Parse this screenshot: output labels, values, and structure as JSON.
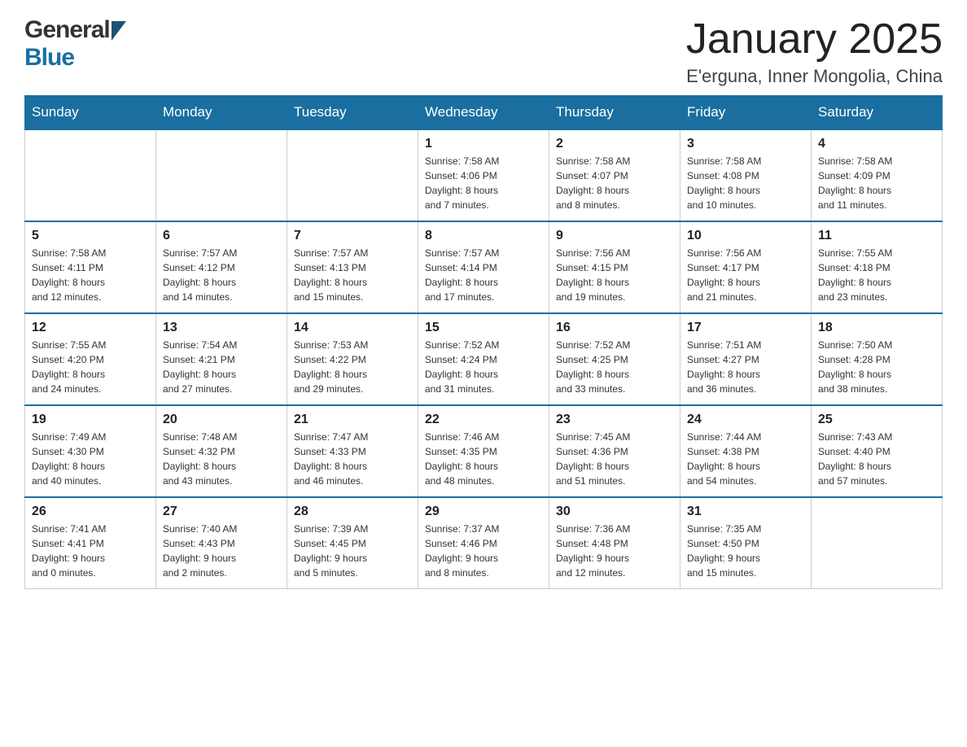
{
  "logo": {
    "general": "General",
    "blue": "Blue"
  },
  "title": "January 2025",
  "subtitle": "E'erguna, Inner Mongolia, China",
  "days_header": [
    "Sunday",
    "Monday",
    "Tuesday",
    "Wednesday",
    "Thursday",
    "Friday",
    "Saturday"
  ],
  "weeks": [
    [
      {
        "day": "",
        "info": ""
      },
      {
        "day": "",
        "info": ""
      },
      {
        "day": "",
        "info": ""
      },
      {
        "day": "1",
        "info": "Sunrise: 7:58 AM\nSunset: 4:06 PM\nDaylight: 8 hours\nand 7 minutes."
      },
      {
        "day": "2",
        "info": "Sunrise: 7:58 AM\nSunset: 4:07 PM\nDaylight: 8 hours\nand 8 minutes."
      },
      {
        "day": "3",
        "info": "Sunrise: 7:58 AM\nSunset: 4:08 PM\nDaylight: 8 hours\nand 10 minutes."
      },
      {
        "day": "4",
        "info": "Sunrise: 7:58 AM\nSunset: 4:09 PM\nDaylight: 8 hours\nand 11 minutes."
      }
    ],
    [
      {
        "day": "5",
        "info": "Sunrise: 7:58 AM\nSunset: 4:11 PM\nDaylight: 8 hours\nand 12 minutes."
      },
      {
        "day": "6",
        "info": "Sunrise: 7:57 AM\nSunset: 4:12 PM\nDaylight: 8 hours\nand 14 minutes."
      },
      {
        "day": "7",
        "info": "Sunrise: 7:57 AM\nSunset: 4:13 PM\nDaylight: 8 hours\nand 15 minutes."
      },
      {
        "day": "8",
        "info": "Sunrise: 7:57 AM\nSunset: 4:14 PM\nDaylight: 8 hours\nand 17 minutes."
      },
      {
        "day": "9",
        "info": "Sunrise: 7:56 AM\nSunset: 4:15 PM\nDaylight: 8 hours\nand 19 minutes."
      },
      {
        "day": "10",
        "info": "Sunrise: 7:56 AM\nSunset: 4:17 PM\nDaylight: 8 hours\nand 21 minutes."
      },
      {
        "day": "11",
        "info": "Sunrise: 7:55 AM\nSunset: 4:18 PM\nDaylight: 8 hours\nand 23 minutes."
      }
    ],
    [
      {
        "day": "12",
        "info": "Sunrise: 7:55 AM\nSunset: 4:20 PM\nDaylight: 8 hours\nand 24 minutes."
      },
      {
        "day": "13",
        "info": "Sunrise: 7:54 AM\nSunset: 4:21 PM\nDaylight: 8 hours\nand 27 minutes."
      },
      {
        "day": "14",
        "info": "Sunrise: 7:53 AM\nSunset: 4:22 PM\nDaylight: 8 hours\nand 29 minutes."
      },
      {
        "day": "15",
        "info": "Sunrise: 7:52 AM\nSunset: 4:24 PM\nDaylight: 8 hours\nand 31 minutes."
      },
      {
        "day": "16",
        "info": "Sunrise: 7:52 AM\nSunset: 4:25 PM\nDaylight: 8 hours\nand 33 minutes."
      },
      {
        "day": "17",
        "info": "Sunrise: 7:51 AM\nSunset: 4:27 PM\nDaylight: 8 hours\nand 36 minutes."
      },
      {
        "day": "18",
        "info": "Sunrise: 7:50 AM\nSunset: 4:28 PM\nDaylight: 8 hours\nand 38 minutes."
      }
    ],
    [
      {
        "day": "19",
        "info": "Sunrise: 7:49 AM\nSunset: 4:30 PM\nDaylight: 8 hours\nand 40 minutes."
      },
      {
        "day": "20",
        "info": "Sunrise: 7:48 AM\nSunset: 4:32 PM\nDaylight: 8 hours\nand 43 minutes."
      },
      {
        "day": "21",
        "info": "Sunrise: 7:47 AM\nSunset: 4:33 PM\nDaylight: 8 hours\nand 46 minutes."
      },
      {
        "day": "22",
        "info": "Sunrise: 7:46 AM\nSunset: 4:35 PM\nDaylight: 8 hours\nand 48 minutes."
      },
      {
        "day": "23",
        "info": "Sunrise: 7:45 AM\nSunset: 4:36 PM\nDaylight: 8 hours\nand 51 minutes."
      },
      {
        "day": "24",
        "info": "Sunrise: 7:44 AM\nSunset: 4:38 PM\nDaylight: 8 hours\nand 54 minutes."
      },
      {
        "day": "25",
        "info": "Sunrise: 7:43 AM\nSunset: 4:40 PM\nDaylight: 8 hours\nand 57 minutes."
      }
    ],
    [
      {
        "day": "26",
        "info": "Sunrise: 7:41 AM\nSunset: 4:41 PM\nDaylight: 9 hours\nand 0 minutes."
      },
      {
        "day": "27",
        "info": "Sunrise: 7:40 AM\nSunset: 4:43 PM\nDaylight: 9 hours\nand 2 minutes."
      },
      {
        "day": "28",
        "info": "Sunrise: 7:39 AM\nSunset: 4:45 PM\nDaylight: 9 hours\nand 5 minutes."
      },
      {
        "day": "29",
        "info": "Sunrise: 7:37 AM\nSunset: 4:46 PM\nDaylight: 9 hours\nand 8 minutes."
      },
      {
        "day": "30",
        "info": "Sunrise: 7:36 AM\nSunset: 4:48 PM\nDaylight: 9 hours\nand 12 minutes."
      },
      {
        "day": "31",
        "info": "Sunrise: 7:35 AM\nSunset: 4:50 PM\nDaylight: 9 hours\nand 15 minutes."
      },
      {
        "day": "",
        "info": ""
      }
    ]
  ]
}
